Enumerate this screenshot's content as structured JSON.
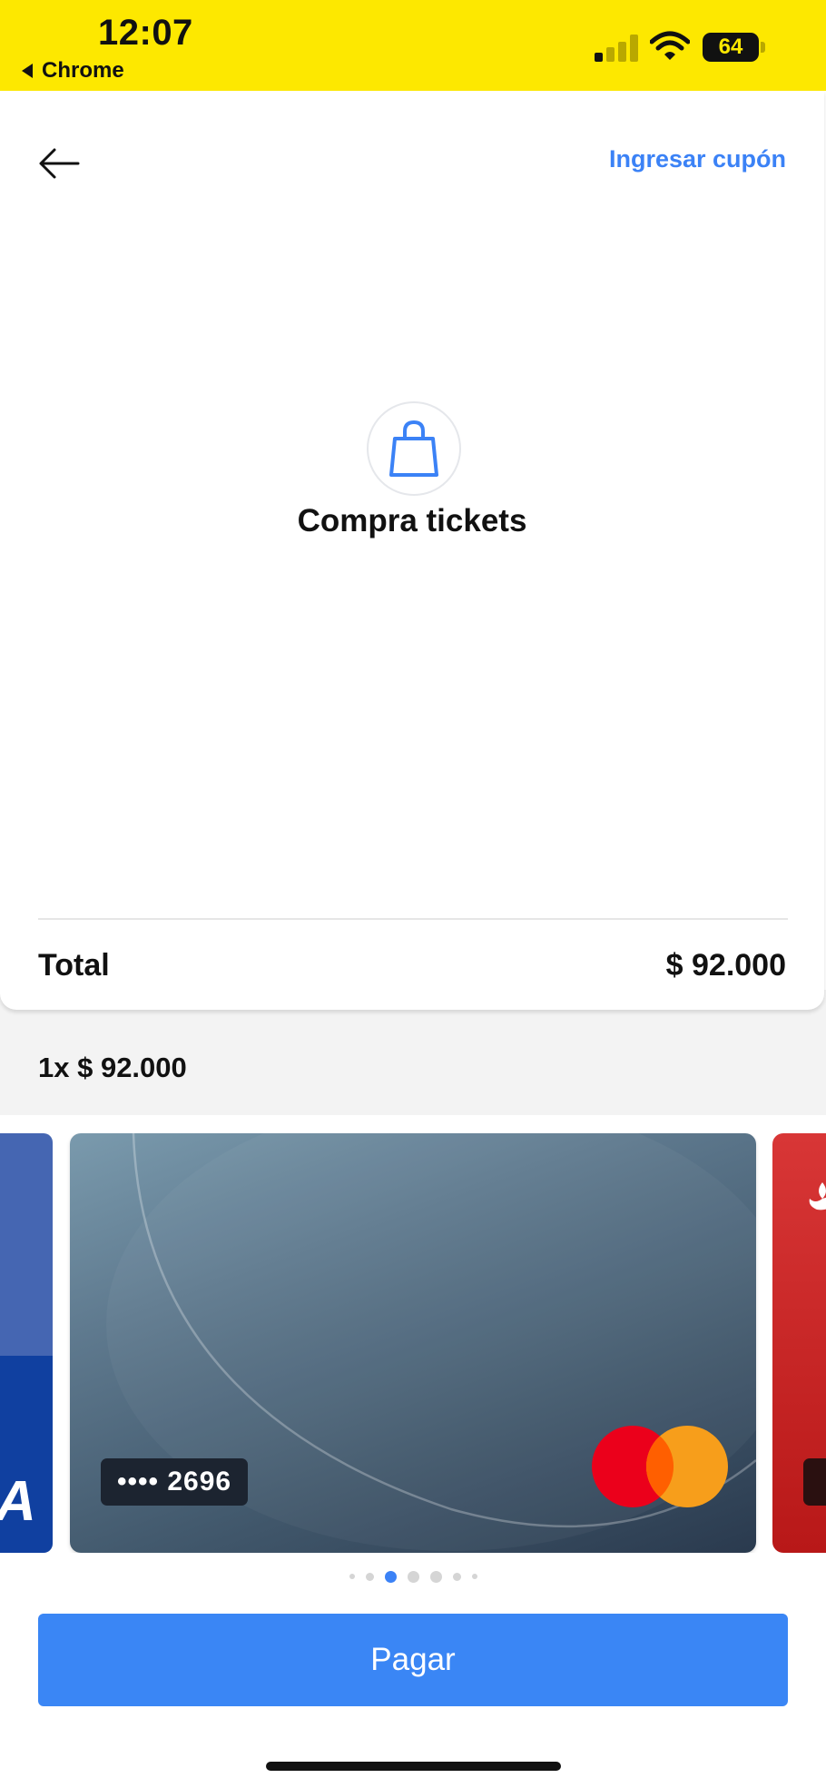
{
  "status_bar": {
    "time": "12:07",
    "back_app": "Chrome",
    "battery": "64",
    "background_color": "#fde800"
  },
  "header": {
    "back_icon": "arrow-left-icon",
    "coupon_label": "Ingresar cupón"
  },
  "purchase": {
    "icon": "shopping-bag-icon",
    "title": "Compra tickets"
  },
  "summary": {
    "total_label": "Total",
    "total_value": "$ 92.000",
    "installments": "1x $ 92.000"
  },
  "cards": {
    "items": [
      {
        "brand": "A",
        "color": "#1040a0"
      },
      {
        "masked_number": "•••• 2696",
        "brand_icon": "mastercard-logo-icon"
      },
      {
        "brand_icon": "santander-flame-icon",
        "color": "#c82020"
      }
    ],
    "pager": {
      "count": 7,
      "active_index": 2
    }
  },
  "actions": {
    "pay_label": "Pagar",
    "accent_color": "#3a86f5"
  }
}
